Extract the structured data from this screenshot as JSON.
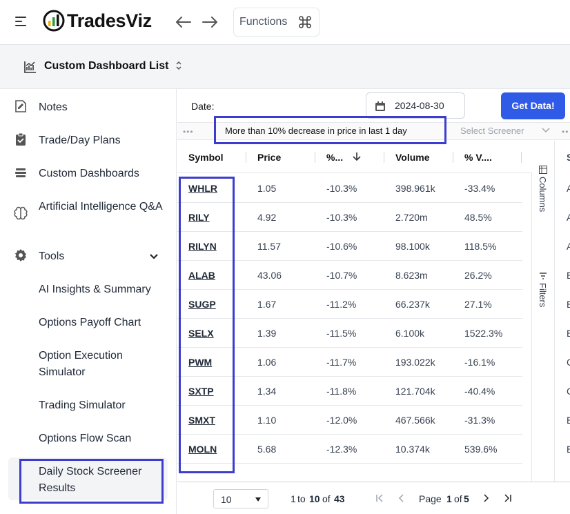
{
  "header": {
    "app_name": "TradesViz",
    "functions_label": "Functions"
  },
  "dashboard": {
    "title": "Custom Dashboard List"
  },
  "sidebar": {
    "items": [
      {
        "label": "Notes"
      },
      {
        "label": "Trade/Day Plans"
      },
      {
        "label": "Custom Dashboards"
      },
      {
        "label": "Artificial Intelligence Q&A"
      },
      {
        "label": "Tools"
      }
    ],
    "tools_sub": [
      {
        "label": "AI Insights & Summary"
      },
      {
        "label": "Options Payoff Chart"
      },
      {
        "label": "Option Execution Simulator"
      },
      {
        "label": "Trading Simulator"
      },
      {
        "label": "Options Flow Scan"
      },
      {
        "label": "Daily Stock Screener Results"
      }
    ]
  },
  "main": {
    "date_label": "Date:",
    "date_value": "2024-08-30",
    "get_data_label": "Get Data!",
    "screener_text": "More than 10% decrease in price in last 1 day",
    "select_screener_placeholder": "Select Screener",
    "columns_label": "Columns",
    "filters_label": "Filters",
    "grid": {
      "headers": [
        "Symbol",
        "Price",
        "%...",
        "Volume",
        "% V...."
      ],
      "rows": [
        {
          "symbol": "WHLR",
          "price": "1.05",
          "change": "-10.3%",
          "volume": "398.961k",
          "vchange": "-33.4%"
        },
        {
          "symbol": "RILY",
          "price": "4.92",
          "change": "-10.3%",
          "volume": "2.720m",
          "vchange": "48.5%"
        },
        {
          "symbol": "RILYN",
          "price": "11.57",
          "change": "-10.6%",
          "volume": "98.100k",
          "vchange": "118.5%"
        },
        {
          "symbol": "ALAB",
          "price": "43.06",
          "change": "-10.7%",
          "volume": "8.623m",
          "vchange": "26.2%"
        },
        {
          "symbol": "SUGP",
          "price": "1.67",
          "change": "-11.2%",
          "volume": "66.237k",
          "vchange": "27.1%"
        },
        {
          "symbol": "SELX",
          "price": "1.39",
          "change": "-11.5%",
          "volume": "6.100k",
          "vchange": "1522.3%"
        },
        {
          "symbol": "PWM",
          "price": "1.06",
          "change": "-11.7%",
          "volume": "193.022k",
          "vchange": "-16.1%"
        },
        {
          "symbol": "SXTP",
          "price": "1.34",
          "change": "-11.8%",
          "volume": "121.704k",
          "vchange": "-40.4%"
        },
        {
          "symbol": "SMXT",
          "price": "1.10",
          "change": "-12.0%",
          "volume": "467.566k",
          "vchange": "-31.3%"
        },
        {
          "symbol": "MOLN",
          "price": "5.68",
          "change": "-12.3%",
          "volume": "10.374k",
          "vchange": "539.6%"
        }
      ]
    },
    "overflow": {
      "header": "S",
      "cells": [
        "A",
        "A",
        "A",
        "E",
        "E",
        "E",
        "C",
        "C",
        "E",
        "E"
      ]
    },
    "pager": {
      "page_size": "10",
      "range_start": "1",
      "range_to": "to",
      "range_end": "10",
      "range_of": "of",
      "total": "43",
      "page_word": "Page",
      "page_current": "1",
      "page_of": "of",
      "page_total": "5"
    }
  },
  "colors": {
    "accent": "#2f5be7",
    "highlight": "#3c3ccf"
  }
}
